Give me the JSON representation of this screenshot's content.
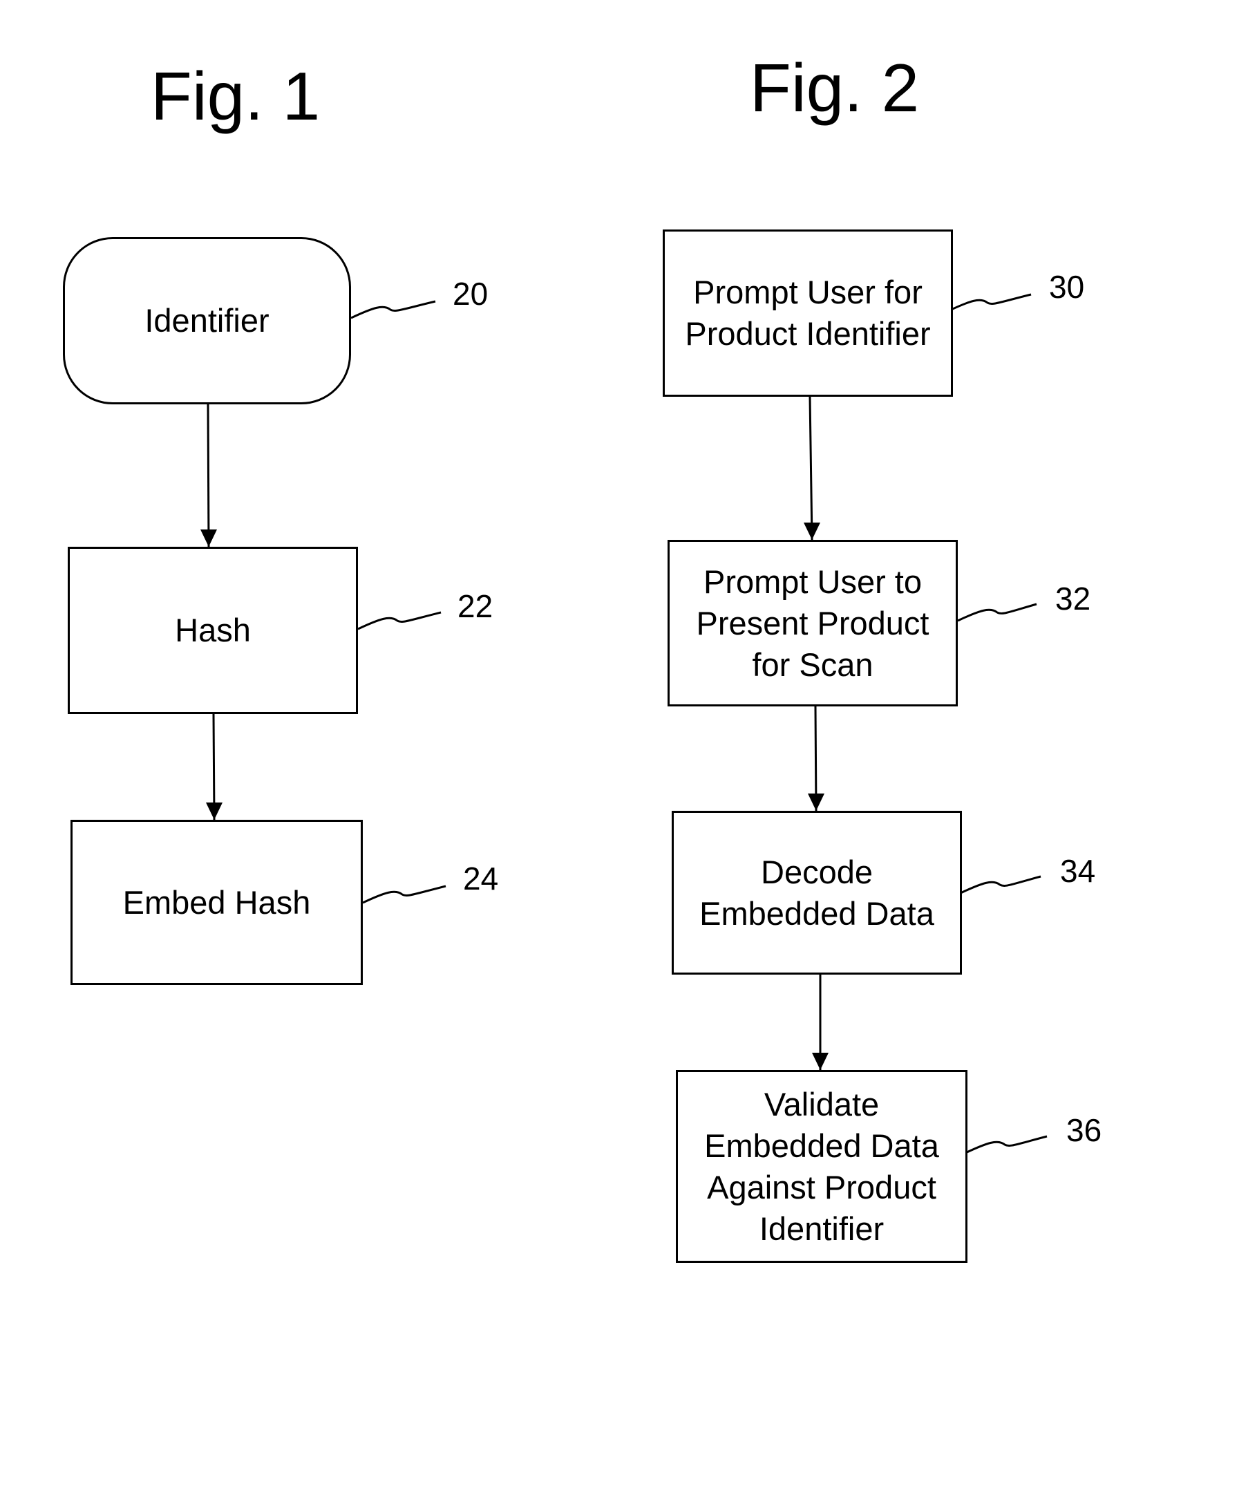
{
  "fig1": {
    "title": "Fig. 1",
    "steps": [
      {
        "ref": "20",
        "shape": "rounded",
        "lines": [
          "Identifier"
        ]
      },
      {
        "ref": "22",
        "shape": "rect",
        "lines": [
          "Hash"
        ]
      },
      {
        "ref": "24",
        "shape": "rect",
        "lines": [
          "Embed Hash"
        ]
      }
    ]
  },
  "fig2": {
    "title": "Fig. 2",
    "steps": [
      {
        "ref": "30",
        "shape": "rect",
        "lines": [
          "Prompt User for",
          "Product Identifier"
        ]
      },
      {
        "ref": "32",
        "shape": "rect",
        "lines": [
          "Prompt User to",
          "Present Product",
          "for Scan"
        ]
      },
      {
        "ref": "34",
        "shape": "rect",
        "lines": [
          "Decode",
          "Embedded Data"
        ]
      },
      {
        "ref": "36",
        "shape": "rect",
        "lines": [
          "Validate",
          "Embedded Data",
          "Against Product",
          "Identifier"
        ]
      }
    ]
  }
}
